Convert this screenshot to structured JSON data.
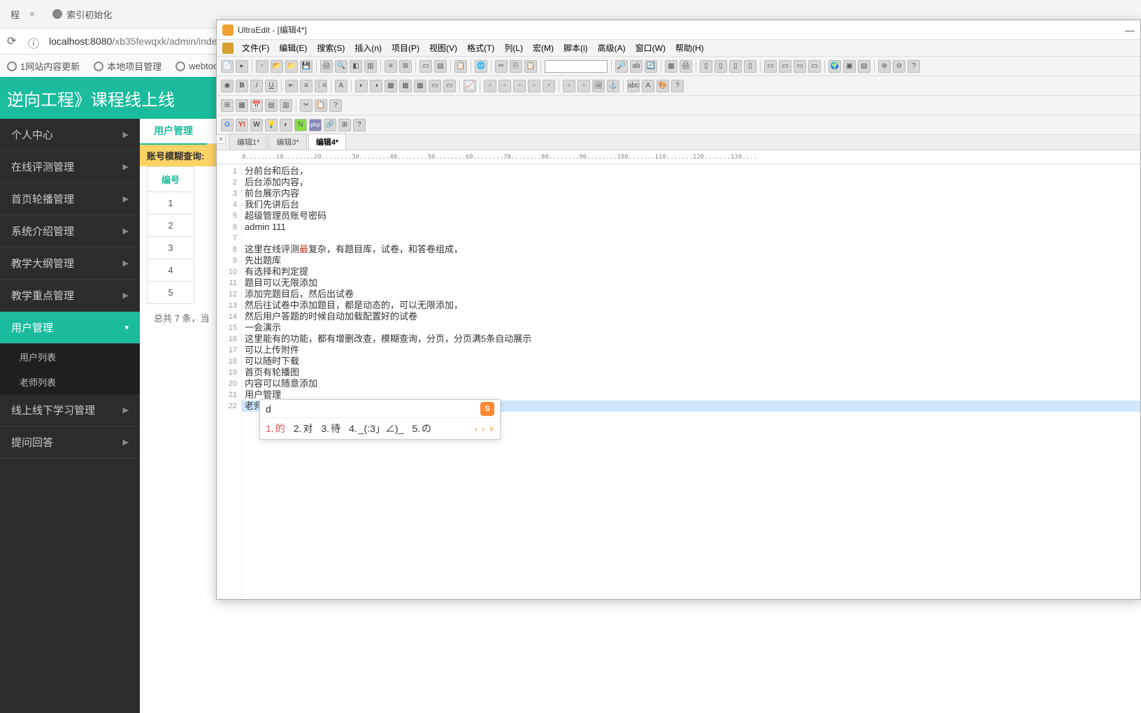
{
  "browser": {
    "tabs": [
      {
        "title": "程",
        "close": true
      },
      {
        "title": "索引初始化"
      }
    ],
    "url_host": "localhost:8080",
    "url_path": "/xb35fewqxk/admin/inde",
    "info_icon": "ⓘ",
    "bookmarks": [
      "1网站内容更新",
      "本地项目管理",
      "webtool"
    ]
  },
  "webapp": {
    "header_title": "逆向工程》课程线上线",
    "sidebar": {
      "items": [
        {
          "label": "个人中心",
          "arrow": "▶",
          "active": false
        },
        {
          "label": "在线评测管理",
          "arrow": "▶",
          "active": false
        },
        {
          "label": "首页轮播管理",
          "arrow": "▶",
          "active": false
        },
        {
          "label": "系统介绍管理",
          "arrow": "▶",
          "active": false
        },
        {
          "label": "教学大纲管理",
          "arrow": "▶",
          "active": false
        },
        {
          "label": "教学重点管理",
          "arrow": "▶",
          "active": false
        },
        {
          "label": "用户管理",
          "arrow": "▾",
          "active": true
        },
        {
          "label": "线上线下学习管理",
          "arrow": "▶",
          "active": false
        },
        {
          "label": "提问回答",
          "arrow": "▶",
          "active": false
        }
      ],
      "sub_items": [
        "用户列表",
        "老师列表"
      ]
    },
    "content": {
      "tab_label": "用户管理",
      "query_label": "账号模糊查询:",
      "table_header": "编号",
      "table_rows": [
        "1",
        "2",
        "3",
        "4",
        "5"
      ],
      "footer": "总共 7 条，当"
    }
  },
  "ultraedit": {
    "title": "UltraEdit - [编辑4*]",
    "menu": [
      "文件(F)",
      "编辑(E)",
      "搜索(S)",
      "插入(n)",
      "项目(P)",
      "视图(V)",
      "格式(T)",
      "列(L)",
      "宏(M)",
      "脚本(i)",
      "高级(A)",
      "窗口(W)",
      "帮助(H)"
    ],
    "tabs": [
      "编辑1*",
      "编辑3*",
      "编辑4*"
    ],
    "active_tab": 2,
    "ruler": "0........10........20........30........40........50........60........70........80........90........100.......110.......120.......130....",
    "lines": [
      "分前台和后台，",
      "后台添加内容，",
      "前台展示内容",
      "我们先讲后台",
      "超级管理员账号密码",
      "admin 111",
      "",
      "这里在线评测最复杂，有题目库，试卷，和答卷组成，",
      "先出题库",
      "有选择和判定提",
      "题目可以无限添加",
      "添加完题目后，然后出试卷",
      "然后往试卷中添加题目，都是动态的，可以无限添加，",
      "然后用户答题的时候自动加载配置好的试卷",
      "一会演示",
      "这里能有的功能，都有增删改查，模糊查询，分页，分页满5条自动展示",
      "可以上传附件",
      "可以随时下载",
      "首页有轮播图",
      "内容可以随意添加",
      "用户管理",
      "老师"
    ],
    "cursor_line": 22,
    "line8_hl_pre": "这里在线评测",
    "line8_hl_mid": "最",
    "line8_hl_post": "复杂，有题目库，试卷，和答卷组成，"
  },
  "ime": {
    "input": "d",
    "logo": "S",
    "candidates": [
      {
        "n": "1.",
        "t": "的"
      },
      {
        "n": "2.",
        "t": "对"
      },
      {
        "n": "3.",
        "t": "待"
      },
      {
        "n": "4.",
        "t": "_(:3」∠)_"
      },
      {
        "n": "5.",
        "t": "の"
      }
    ],
    "nav": [
      "‹",
      "›",
      "˅"
    ]
  }
}
